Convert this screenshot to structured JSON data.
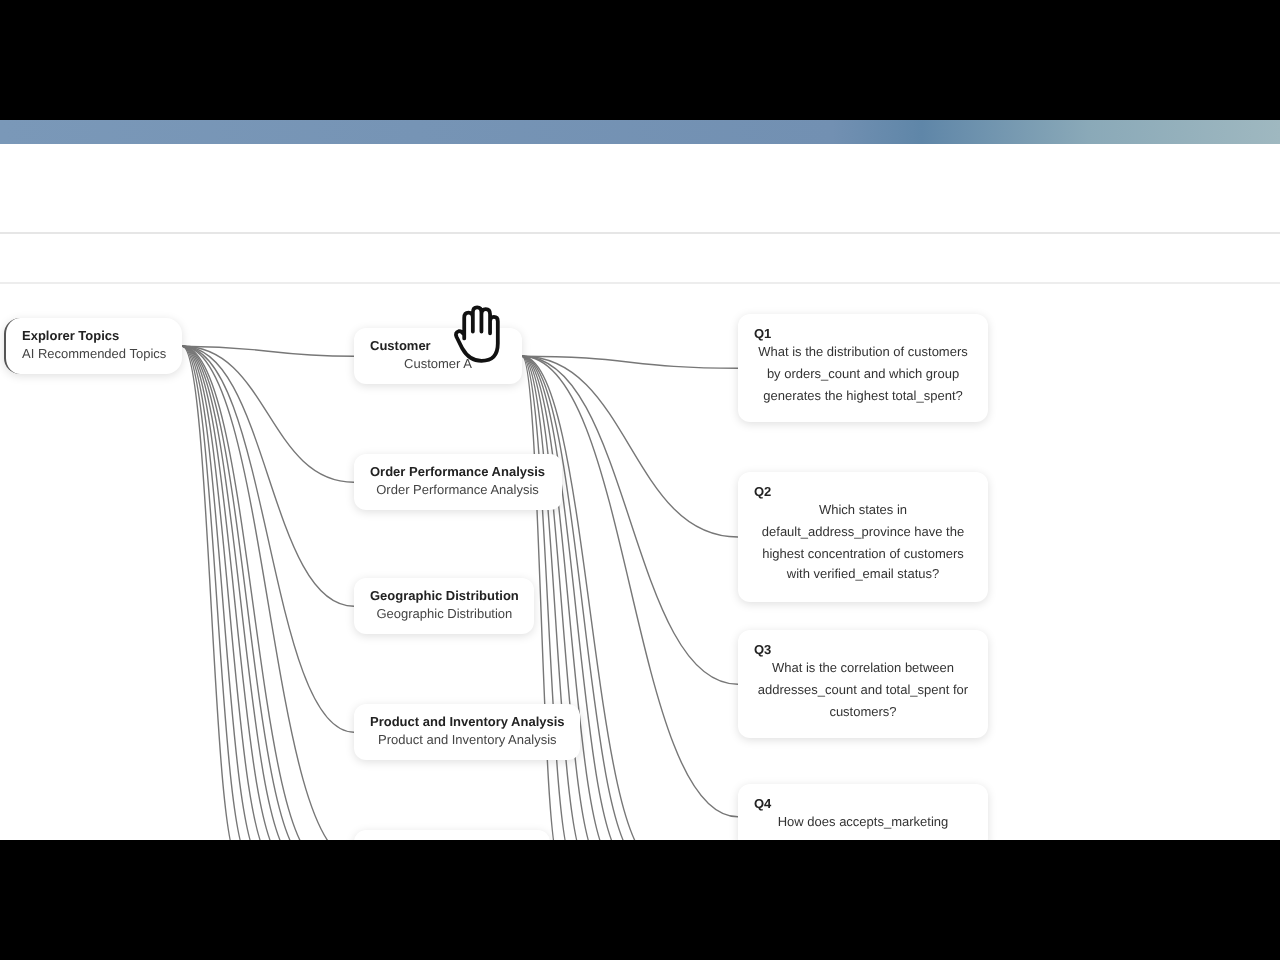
{
  "root": {
    "title": "Explorer Topics",
    "subtitle": "AI Recommended Topics"
  },
  "topics": [
    {
      "title": "Customer",
      "subtitle": "Customer A"
    },
    {
      "title": "Order Performance Analysis",
      "subtitle": "Order Performance Analysis"
    },
    {
      "title": "Geographic Distribution",
      "subtitle": "Geographic Distribution"
    },
    {
      "title": "Product and Inventory Analysis",
      "subtitle": "Product and Inventory Analysis"
    }
  ],
  "questions": [
    {
      "label": "Q1",
      "text": "What is the distribution of customers by orders_count and which group generates the highest total_spent?"
    },
    {
      "label": "Q2",
      "text": "Which states in default_address_province have the highest concentration of customers with verified_email status?"
    },
    {
      "label": "Q3",
      "text": "What is the correlation between addresses_count and total_spent for customers?"
    },
    {
      "label": "Q4",
      "text": "How does accepts_marketing"
    }
  ]
}
